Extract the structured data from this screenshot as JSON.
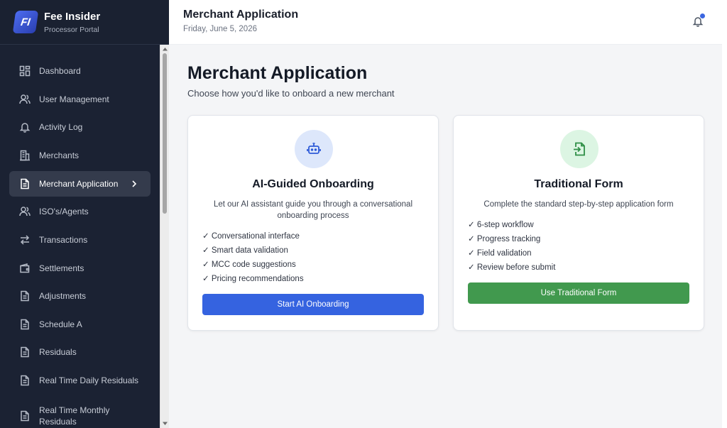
{
  "brand": {
    "logo": "FI",
    "name": "Fee Insider",
    "subtitle": "Processor Portal"
  },
  "sidebar": {
    "items": [
      {
        "label": "Dashboard",
        "icon": "dashboard-icon"
      },
      {
        "label": "User Management",
        "icon": "users-icon"
      },
      {
        "label": "Activity Log",
        "icon": "bell-icon"
      },
      {
        "label": "Merchants",
        "icon": "building-icon"
      },
      {
        "label": "Merchant Application",
        "icon": "document-icon",
        "active": true
      },
      {
        "label": "ISO's/Agents",
        "icon": "users-icon"
      },
      {
        "label": "Transactions",
        "icon": "arrows-icon"
      },
      {
        "label": "Settlements",
        "icon": "wallet-icon"
      },
      {
        "label": "Adjustments",
        "icon": "document-icon"
      },
      {
        "label": "Schedule A",
        "icon": "document-icon"
      },
      {
        "label": "Residuals",
        "icon": "document-icon"
      },
      {
        "label": "Real Time Daily Residuals",
        "icon": "document-icon"
      },
      {
        "label": "Real Time Monthly Residuals",
        "icon": "document-icon"
      }
    ]
  },
  "header": {
    "title": "Merchant Application",
    "date": "Friday, June 5, 2026"
  },
  "main": {
    "title": "Merchant Application",
    "subtitle": "Choose how you'd like to onboard a new merchant",
    "cards": {
      "ai": {
        "icon": "robot-icon",
        "title": "AI-Guided Onboarding",
        "description": "Let our AI assistant guide you through a conversational onboarding process",
        "features": [
          "✓ Conversational interface",
          "✓ Smart data validation",
          "✓ MCC code suggestions",
          "✓ Pricing recommendations"
        ],
        "button": "Start AI Onboarding"
      },
      "traditional": {
        "icon": "file-import-icon",
        "title": "Traditional Form",
        "description": "Complete the standard step-by-step application form",
        "features": [
          "✓ 6-step workflow",
          "✓ Progress tracking",
          "✓ Field validation",
          "✓ Review before submit"
        ],
        "button": "Use Traditional Form"
      }
    }
  },
  "colors": {
    "sidebar": "#1b2233",
    "primary": "#3563e0",
    "success": "#41994e"
  }
}
